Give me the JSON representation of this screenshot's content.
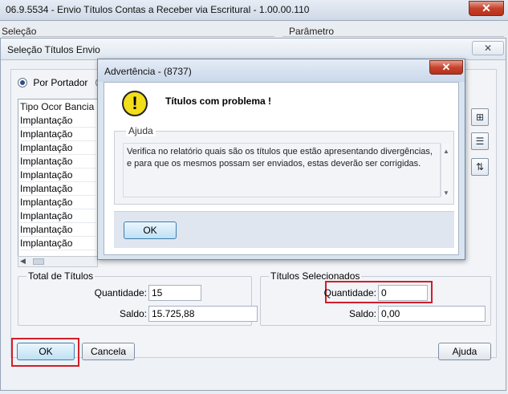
{
  "main": {
    "title": "06.9.5534 - Envio Títulos Contas a Receber via Escritural - 1.00.00.110",
    "close_label": "✕",
    "section_selecao": "Seleção",
    "section_parametro": "Parâmetro"
  },
  "selection_dialog": {
    "title": "Seleção Títulos Envio",
    "close_label": "✕",
    "radio_portador": "Por Portador",
    "list": {
      "header": "Tipo Ocor Bancia",
      "rows": [
        "Implantação",
        "Implantação",
        "Implantação",
        "Implantação",
        "Implantação",
        "Implantação",
        "Implantação",
        "Implantação",
        "Implantação",
        "Implantação"
      ]
    },
    "total": {
      "group_label": "Total de Títulos",
      "quantidade_label": "Quantidade:",
      "quantidade_value": "15",
      "saldo_label": "Saldo:",
      "saldo_value": "15.725,88"
    },
    "selecionados": {
      "group_label": "Títulos Selecionados",
      "quantidade_label": "Quantidade:",
      "quantidade_value": "0",
      "saldo_label": "Saldo:",
      "saldo_value": "0,00"
    },
    "buttons": {
      "ok": "OK",
      "cancela": "Cancela",
      "ajuda": "Ajuda"
    }
  },
  "warning_dialog": {
    "title": "Advertência - (8737)",
    "close_label": "✕",
    "message": "Títulos com problema !",
    "ajuda_label": "Ajuda",
    "ajuda_text": "Verifica no relatório quais são os títulos que estão apresentando divergências, e para que os mesmos possam ser enviados, estas deverão ser corrigidas.",
    "ok_label": "OK"
  },
  "colors": {
    "highlight_red": "#d21e2a",
    "warning_yellow": "#f2de1b"
  }
}
